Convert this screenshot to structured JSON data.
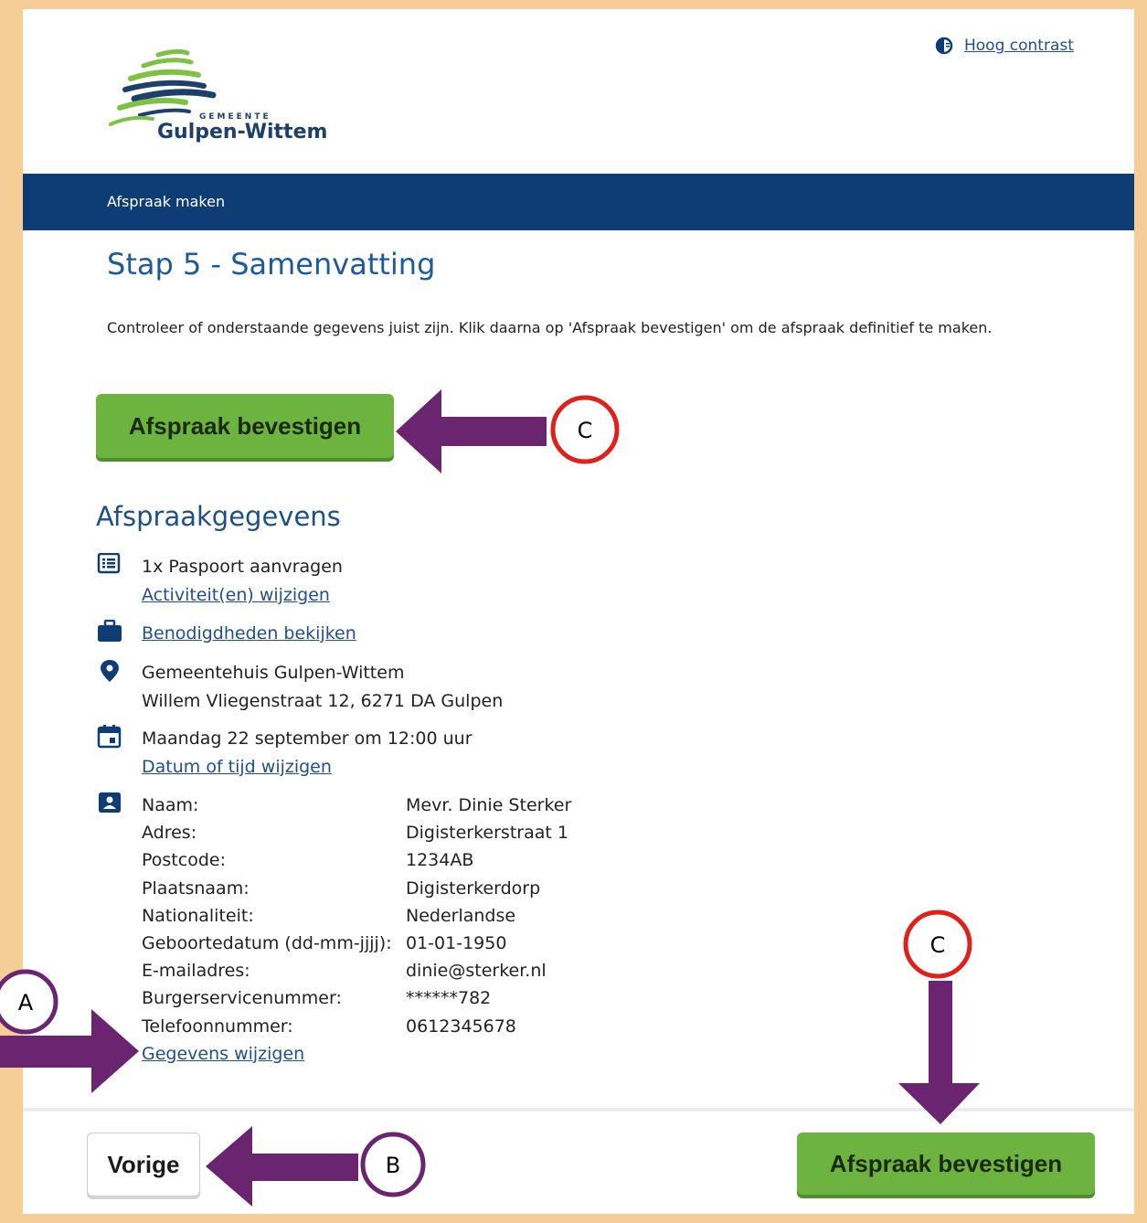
{
  "header": {
    "contrast_label": "Hoog contrast",
    "logo_small": "GEMEENTE",
    "logo_name": "Gulpen-Wittem"
  },
  "nav": {
    "title": "Afspraak maken"
  },
  "main": {
    "step_title": "Stap 5 - Samenvatting",
    "intro": "Controleer of onderstaande gegevens juist zijn. Klik daarna op 'Afspraak bevestigen' om de afspraak definitief te maken.",
    "confirm_label": "Afspraak bevestigen",
    "section_title": "Afspraakgegevens",
    "activity": "1x Paspoort aanvragen",
    "activity_link": "Activiteit(en) wijzigen",
    "requirements_link": "Benodigdheden bekijken",
    "location_name": "Gemeentehuis Gulpen-Wittem",
    "location_address": "Willem Vliegenstraat 12, 6271 DA Gulpen",
    "datetime": "Maandag 22 september om 12:00 uur",
    "datetime_link": "Datum of tijd wijzigen",
    "personal": [
      {
        "label": "Naam:",
        "value": "Mevr. Dinie Sterker"
      },
      {
        "label": "Adres:",
        "value": "Digisterkerstraat 1"
      },
      {
        "label": "Postcode:",
        "value": "1234AB"
      },
      {
        "label": "Plaatsnaam:",
        "value": "Digisterkerdorp"
      },
      {
        "label": "Nationaliteit:",
        "value": "Nederlandse"
      },
      {
        "label": "Geboortedatum (dd-mm-jjjj):",
        "value": "01-01-1950"
      },
      {
        "label": "E-mailadres:",
        "value": "dinie@sterker.nl"
      },
      {
        "label": "Burgerservicenummer:",
        "value": "******782"
      },
      {
        "label": "Telefoonnummer:",
        "value": "0612345678"
      }
    ],
    "edit_data_link": "Gegevens wijzigen"
  },
  "footer": {
    "back_label": "Vorige",
    "confirm_label": "Afspraak bevestigen"
  },
  "annotations": {
    "marker_a": "A",
    "marker_b": "B",
    "marker_c": "C",
    "arrow_color": "#6b2470",
    "circle_red": "#e0201a",
    "circle_purple": "#6b2470"
  },
  "colors": {
    "frame": "#f6cd97",
    "nav_bg": "#0e3d75",
    "title_blue": "#1e5a97",
    "button_green": "#6cb43f"
  }
}
